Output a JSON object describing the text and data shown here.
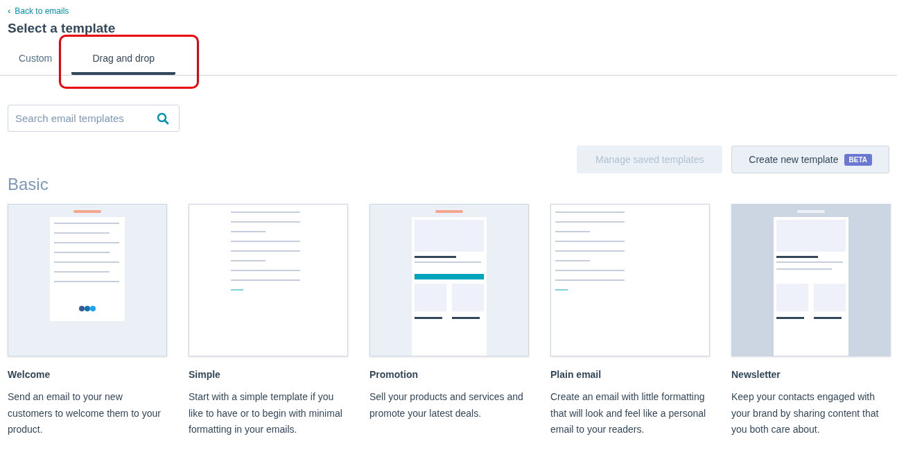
{
  "back_link": {
    "icon": "‹",
    "label": "Back to emails"
  },
  "title": "Select a template",
  "tabs": [
    {
      "label": "Custom",
      "selected": false,
      "highlighted": false
    },
    {
      "label": "Drag and drop",
      "selected": true,
      "highlighted": true
    }
  ],
  "search": {
    "placeholder": "Search email templates"
  },
  "buttons": [
    {
      "label": "Manage saved templates",
      "disabled": true
    },
    {
      "label": "Create new template",
      "disabled": false,
      "badge": "BETA"
    }
  ],
  "section": "Basic",
  "templates": [
    {
      "name": "Welcome",
      "description": "Send an email to your new customers to welcome them to your product."
    },
    {
      "name": "Simple",
      "description": "Start with a simple template if you like to have or to begin with minimal formatting in your emails."
    },
    {
      "name": "Promotion",
      "description": "Sell your products and services and promote your latest deals."
    },
    {
      "name": "Plain email",
      "description": "Create an email with little formatting that will look and feel like a personal email to your readers."
    },
    {
      "name": "Newsletter",
      "description": "Keep your contacts engaged with your brand by sharing content that you both care about."
    }
  ]
}
